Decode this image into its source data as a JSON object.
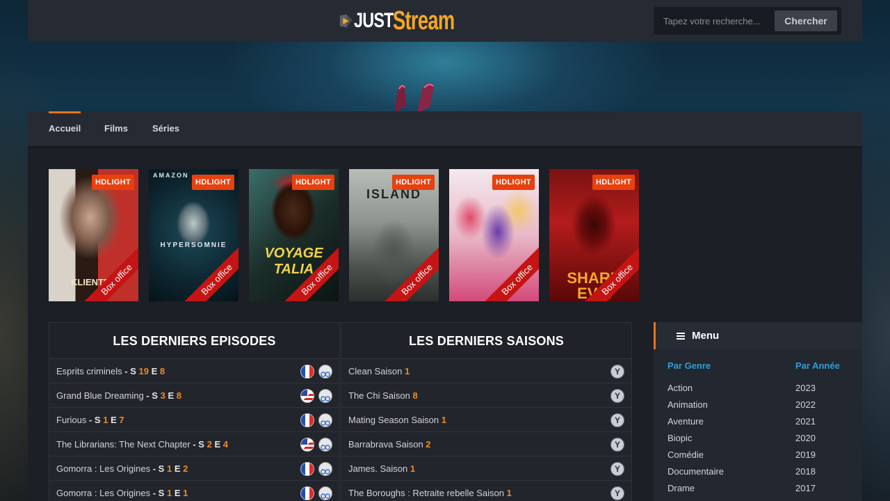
{
  "brand": {
    "part1": "JUST",
    "part2": "Stream"
  },
  "search": {
    "placeholder": "Tapez votre recherche...",
    "button": "Chercher"
  },
  "nav": [
    "Accueil",
    "Films",
    "Séries"
  ],
  "posters": [
    {
      "title": "KLIENTEN",
      "badge": "HDLIGHT",
      "ribbon": "Box office"
    },
    {
      "title": "HYPERSOMNIE",
      "top": "AMAZON",
      "badge": "HDLIGHT",
      "ribbon": "Box office"
    },
    {
      "title": "VOYAGE TALIA",
      "badge": "HDLIGHT",
      "ribbon": "Box office"
    },
    {
      "title": "ISLAND",
      "badge": "HDLIGHT",
      "ribbon": "Box office"
    },
    {
      "title": "",
      "badge": "HDLIGHT",
      "ribbon": "Box office"
    },
    {
      "title": "SHARK EVIL",
      "badge": "HDLIGHT",
      "ribbon": "Box office"
    }
  ],
  "episodes": {
    "heading": "LES DERNIERS EPISODES",
    "items": [
      {
        "name": "Esprits criminels",
        "dash": "- S",
        "s": "19",
        "e_label": "E",
        "e": "8",
        "lang": "fr"
      },
      {
        "name": "Grand Blue Dreaming",
        "dash": "- S",
        "s": "3",
        "e_label": "E",
        "e": "8",
        "lang": "vo"
      },
      {
        "name": "Furious",
        "dash": "- S",
        "s": "1",
        "e_label": "E",
        "e": "7",
        "lang": "fr"
      },
      {
        "name": "The Librarians: The Next Chapter",
        "dash": "- S",
        "s": "2",
        "e_label": "E",
        "e": "4",
        "lang": "vo"
      },
      {
        "name": "Gomorra : Les Origines",
        "dash": "- S",
        "s": "1",
        "e_label": "E",
        "e": "2",
        "lang": "fr"
      },
      {
        "name": "Gomorra : Les Origines",
        "dash": "- S",
        "s": "1",
        "e_label": "E",
        "e": "1",
        "lang": "fr"
      }
    ]
  },
  "seasons": {
    "heading": "LES DERNIERS SAISONS",
    "items": [
      {
        "name": "Clean Saison",
        "num": "1"
      },
      {
        "name": "The Chi Saison",
        "num": "8"
      },
      {
        "name": "Mating Season Saison",
        "num": "1"
      },
      {
        "name": "Barrabrava Saison",
        "num": "2"
      },
      {
        "name": "James. Saison",
        "num": "1"
      },
      {
        "name": "The Boroughs : Retraite rebelle Saison",
        "num": "1"
      }
    ]
  },
  "menu": {
    "title": "Menu",
    "genre_head": "Par Genre",
    "year_head": "Par Année",
    "genres": [
      "Action",
      "Animation",
      "Aventure",
      "Biopic",
      "Comédie",
      "Documentaire",
      "Drame"
    ],
    "years": [
      "2023",
      "2022",
      "2021",
      "2020",
      "2019",
      "2018",
      "2017"
    ]
  },
  "colors": {
    "accent": "#e8731e",
    "badge": "#e8400e",
    "ribbon": "#c41414",
    "link": "#2f9fd6"
  }
}
